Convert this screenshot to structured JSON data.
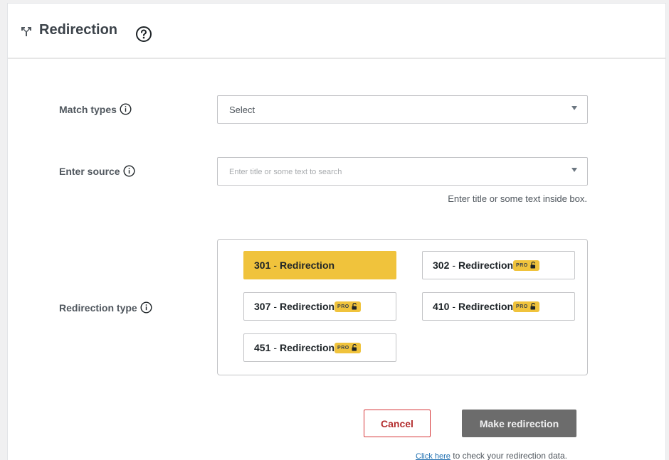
{
  "header": {
    "title": "Redirection",
    "logo_icon": "redirection-logo-icon",
    "help_icon": "question-circle-icon"
  },
  "form": {
    "match_types": {
      "label": "Match types",
      "value": "Select"
    },
    "source": {
      "label": "Enter source",
      "placeholder": "Enter title or some text to search",
      "hint": "Enter title or some text inside box."
    },
    "redirection_type": {
      "label": "Redirection type",
      "options": [
        {
          "code": "301",
          "name": "Redirection",
          "selected": true,
          "pro": false
        },
        {
          "code": "302",
          "name": "Redirection",
          "selected": false,
          "pro": true
        },
        {
          "code": "307",
          "name": "Redirection",
          "selected": false,
          "pro": true
        },
        {
          "code": "410",
          "name": "Redirection",
          "selected": false,
          "pro": true
        },
        {
          "code": "451",
          "name": "Redirection",
          "selected": false,
          "pro": true
        }
      ],
      "pro_badge": "PRO",
      "dash": "-"
    }
  },
  "actions": {
    "cancel": "Cancel",
    "make": "Make redirection"
  },
  "footer": {
    "link": "Click here",
    "text": " to check your redirection data."
  },
  "colors": {
    "accent": "#f0c33c",
    "cancel": "#b32d2e",
    "primary_disabled": "#6c6c6c",
    "link": "#2271b1"
  }
}
